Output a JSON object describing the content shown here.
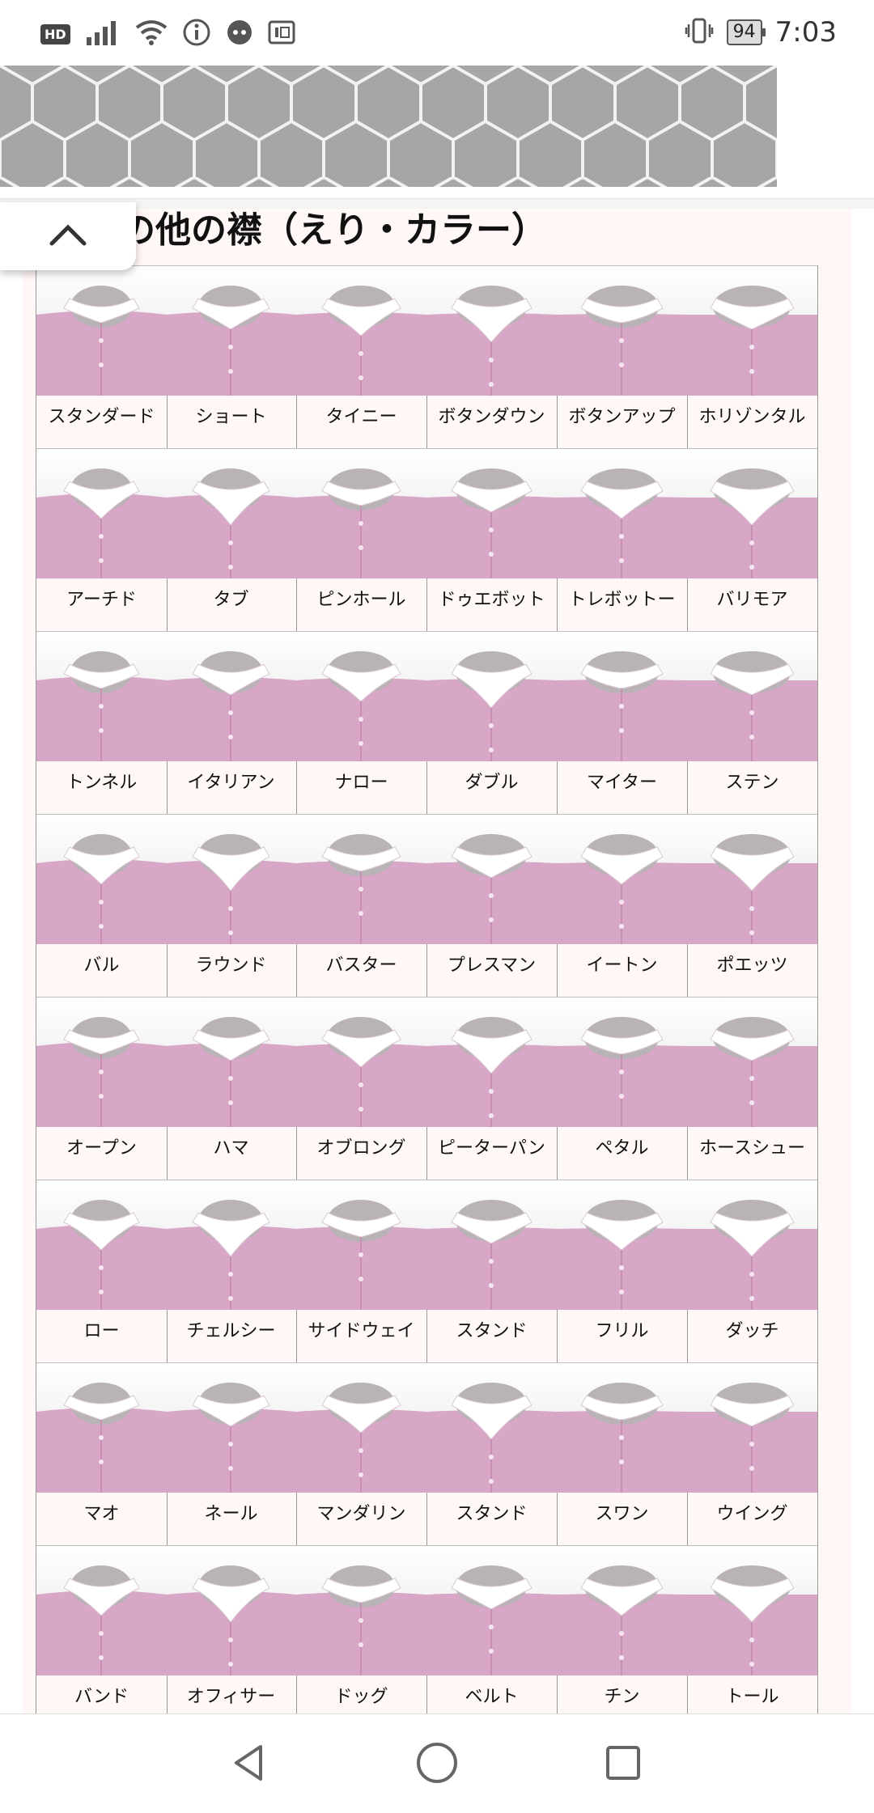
{
  "status_bar": {
    "hd_label": "HD",
    "battery": "94",
    "time": "7:03",
    "icons": [
      "signal-icon",
      "wifi-icon",
      "info-icon",
      "pay-icon",
      "nfc-icon",
      "vibrate-icon",
      "battery-icon"
    ]
  },
  "page": {
    "title": "の他の襟（えり・カラー）",
    "back_to_top_icon": "chevron-up-icon",
    "colors": {
      "shirt_pink": "#d8a6c6",
      "collar_white": "#ffffff",
      "banner_gray": "#a6a6a6",
      "frame_bg": "#fff8f6"
    }
  },
  "collars": [
    {
      "label": "スタンダード"
    },
    {
      "label": "ショート"
    },
    {
      "label": "タイニー"
    },
    {
      "label": "ボタンダウン"
    },
    {
      "label": "ボタンアップ"
    },
    {
      "label": "ホリゾンタル"
    },
    {
      "label": "アーチド"
    },
    {
      "label": "タブ"
    },
    {
      "label": "ピンホール"
    },
    {
      "label": "ドゥエボット"
    },
    {
      "label": "トレボットー"
    },
    {
      "label": "バリモア"
    },
    {
      "label": "トンネル"
    },
    {
      "label": "イタリアン"
    },
    {
      "label": "ナロー"
    },
    {
      "label": "ダブル"
    },
    {
      "label": "マイター"
    },
    {
      "label": "ステン"
    },
    {
      "label": "バル"
    },
    {
      "label": "ラウンド"
    },
    {
      "label": "バスター"
    },
    {
      "label": "プレスマン"
    },
    {
      "label": "イートン"
    },
    {
      "label": "ポエッツ"
    },
    {
      "label": "オープン"
    },
    {
      "label": "ハマ"
    },
    {
      "label": "オブロング"
    },
    {
      "label": "ピーターパン"
    },
    {
      "label": "ペタル"
    },
    {
      "label": "ホースシュー"
    },
    {
      "label": "ロー"
    },
    {
      "label": "チェルシー"
    },
    {
      "label": "サイドウェイ"
    },
    {
      "label": "スタンド"
    },
    {
      "label": "フリル"
    },
    {
      "label": "ダッチ"
    },
    {
      "label": "マオ"
    },
    {
      "label": "ネール"
    },
    {
      "label": "マンダリン"
    },
    {
      "label": "スタンド"
    },
    {
      "label": "スワン"
    },
    {
      "label": "ウイング"
    },
    {
      "label": "バンド"
    },
    {
      "label": "オフィサー"
    },
    {
      "label": "ドッグ"
    },
    {
      "label": "ベルト"
    },
    {
      "label": "チン"
    },
    {
      "label": "トール"
    }
  ],
  "nav_bar": {
    "icons": [
      "back-triangle-icon",
      "home-circle-icon",
      "recents-square-icon"
    ]
  }
}
